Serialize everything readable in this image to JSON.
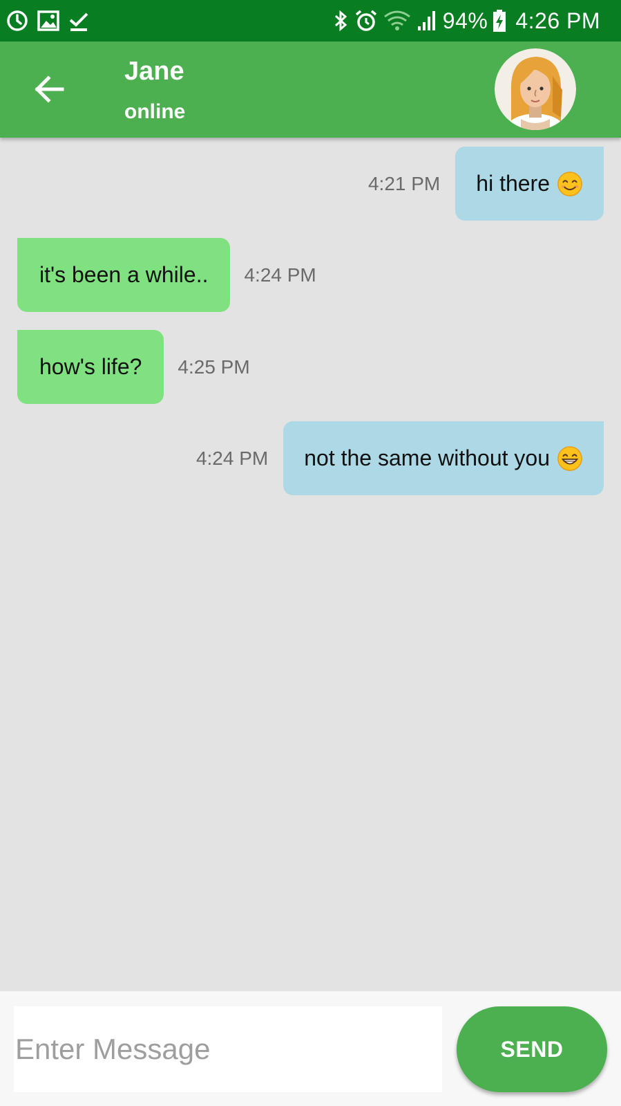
{
  "status_bar": {
    "battery": "94%",
    "time": "4:26 PM",
    "left_icons": [
      "sync-icon",
      "image-icon",
      "download-done-icon"
    ],
    "right_icons": [
      "bluetooth-icon",
      "alarm-icon",
      "wifi-icon",
      "signal-icon",
      "battery-charging-icon"
    ]
  },
  "header": {
    "contact_name": "Jane",
    "contact_status": "online",
    "back_icon": "arrow-back-icon",
    "avatar": "avatar-woman-blonde"
  },
  "messages": [
    {
      "direction": "outgoing",
      "text": "hi there",
      "emoji": "smiling-face-icon",
      "time": "4:21 PM"
    },
    {
      "direction": "incoming",
      "text": "it's been a while..",
      "time": "4:24 PM"
    },
    {
      "direction": "incoming",
      "text": "how's life?",
      "time": "4:25 PM"
    },
    {
      "direction": "outgoing",
      "text": "not the same without you",
      "emoji": "grinning-face-icon",
      "time": "4:24 PM"
    }
  ],
  "composer": {
    "placeholder": "Enter Message",
    "value": "",
    "send_label": "SEND"
  },
  "colors": {
    "status_bar": "#097d21",
    "app_bar": "#4caf50",
    "outgoing_bubble": "#add8e6",
    "incoming_bubble": "#80e180",
    "chat_background": "#e3e3e3",
    "send_button": "#4caf50"
  }
}
